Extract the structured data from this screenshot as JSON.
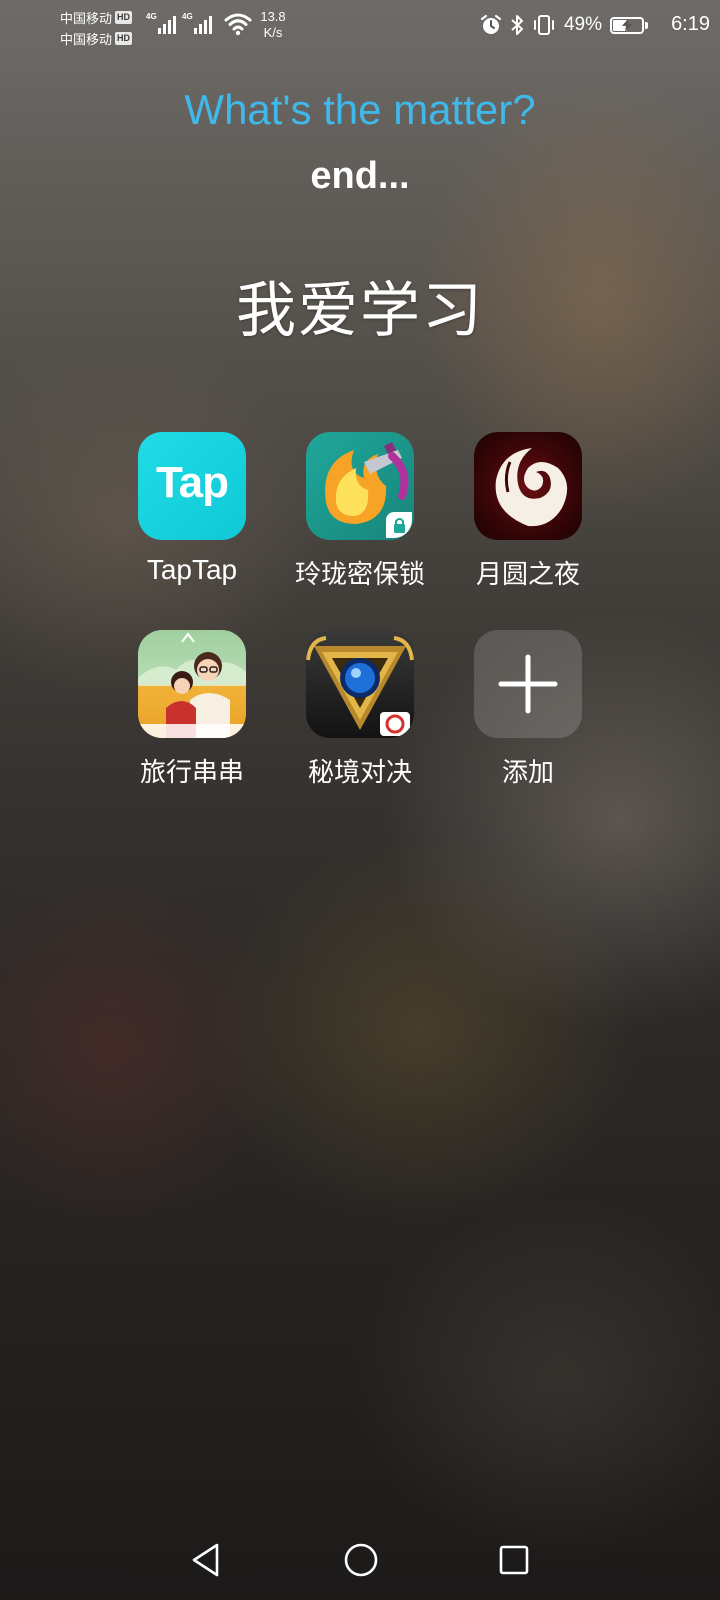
{
  "status_bar": {
    "carrier_1": "中国移动",
    "carrier_2": "中国移动",
    "hd_badge": "HD",
    "network_type": "4G",
    "net_speed_value": "13.8",
    "net_speed_unit": "K/s",
    "battery_percent": "49%",
    "battery_level": 0.49,
    "time": "6:19",
    "icons": [
      "alarm-icon",
      "bluetooth-icon",
      "vibrate-icon",
      "battery-charging-icon"
    ]
  },
  "header": {
    "headline": "What's the matter?",
    "subline": "end...",
    "headline_color": "#3fb8ea"
  },
  "folder": {
    "title": "我爱学习",
    "apps": [
      {
        "label": "TapTap",
        "icon": "taptap-icon"
      },
      {
        "label": "玲珑密保锁",
        "icon": "linglong-lock-icon"
      },
      {
        "label": "月圆之夜",
        "icon": "full-moon-night-icon"
      },
      {
        "label": "旅行串串",
        "icon": "travel-couple-icon"
      },
      {
        "label": "秘境对决",
        "icon": "secret-duel-icon"
      },
      {
        "label": "添加",
        "icon": "plus-icon"
      }
    ],
    "taptap_logo_text": "Tap"
  },
  "nav_bar": {
    "back": "back-triangle-icon",
    "home": "home-circle-icon",
    "recents": "recents-square-icon"
  }
}
